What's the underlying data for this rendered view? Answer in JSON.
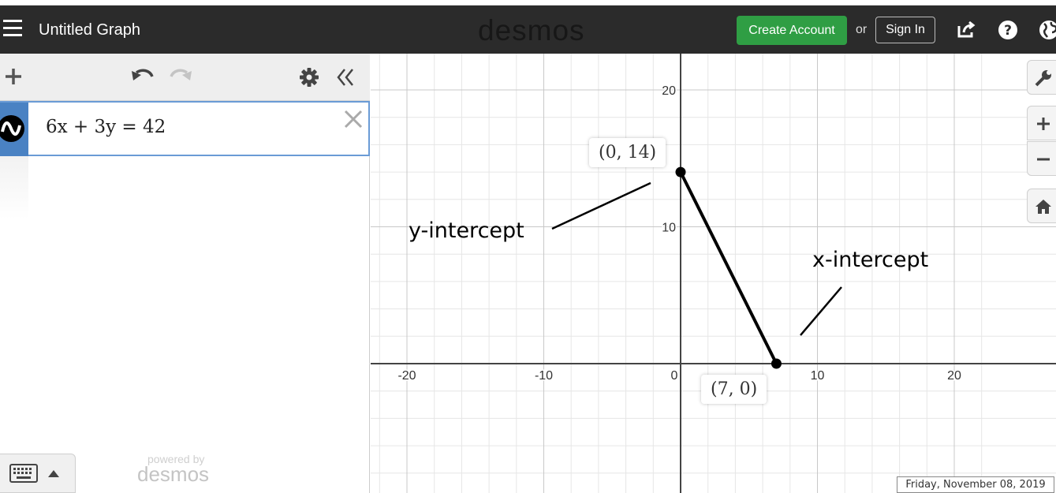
{
  "header": {
    "title": "Untitled Graph",
    "brand": "desmos",
    "create_account_label": "Create Account",
    "or_text": "or",
    "sign_in_label": "Sign In",
    "accent_color": "#2f9e44",
    "icons": [
      "menu-icon",
      "share-icon",
      "help-icon",
      "globe-icon"
    ]
  },
  "sidebar": {
    "toolbar_icons": [
      "add-icon",
      "undo-icon",
      "redo-icon",
      "gear-icon",
      "collapse-icon"
    ],
    "expressions": [
      {
        "latex_display": "6x + 3y = 42",
        "color": "#000000"
      }
    ],
    "powered_by": "powered by",
    "powered_brand": "desmos"
  },
  "graph": {
    "x_range": [
      -27,
      23
    ],
    "y_range": [
      -9,
      21
    ],
    "x_ticks": [
      "-20",
      "-10",
      "0",
      "10",
      "20"
    ],
    "y_ticks": [
      "10",
      "20"
    ],
    "tick_values_x": [
      -20,
      -10,
      0,
      10,
      20
    ],
    "tick_values_y": [
      10,
      20
    ],
    "line_color": "#000000",
    "segment": {
      "from": [
        0,
        14
      ],
      "to": [
        7,
        0
      ]
    },
    "points": [
      {
        "x": 0,
        "y": 14,
        "label": "(0, 14)"
      },
      {
        "x": 7,
        "y": 0,
        "label": "(7, 0)"
      }
    ],
    "annotations": {
      "y_intercept": "y-intercept",
      "x_intercept": "x-intercept"
    },
    "zoom_icons": [
      "wrench-icon",
      "zoom-in-icon",
      "zoom-out-icon",
      "home-icon"
    ]
  },
  "timestamp": "Friday, November 08, 2019"
}
